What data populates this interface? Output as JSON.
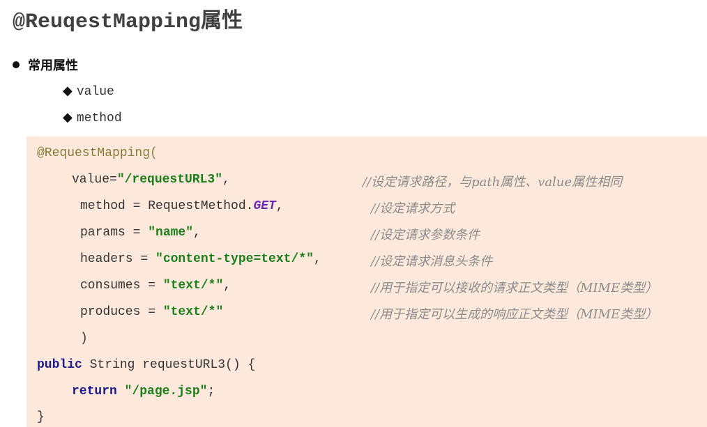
{
  "title": "@ReuqestMapping属性",
  "bullet": {
    "label": "常用属性",
    "items": [
      "value",
      "method"
    ]
  },
  "code": {
    "annotation": "@RequestMapping(",
    "lines": [
      {
        "key": "value=",
        "string": "\"/requestURL3\"",
        "tail": ",",
        "comment": "//设定请求路径，与path属性、value属性相同"
      },
      {
        "key": "method = RequestMethod.",
        "const": "GET",
        "tail": ",",
        "comment": "//设定请求方式"
      },
      {
        "key": "params = ",
        "string": "\"name\"",
        "tail": ",",
        "comment": "//设定请求参数条件"
      },
      {
        "key": "headers = ",
        "string": "\"content-type=text/*\"",
        "tail": ",",
        "comment": "//设定请求消息头条件"
      },
      {
        "key": "consumes = ",
        "string": "\"text/*\"",
        "tail": ",",
        "comment": "//用于指定可以接收的请求正文类型（MIME类型）"
      },
      {
        "key": "produces = ",
        "string": "\"text/*\"",
        "tail": "",
        "comment": "//用于指定可以生成的响应正文类型（MIME类型）"
      }
    ],
    "close_paren": ")",
    "method_keyword": "public",
    "method_sig": " String requestURL3() {",
    "return_keyword": "return",
    "return_value": "\"/page.jsp\"",
    "return_tail": ";",
    "close_brace": "}"
  }
}
